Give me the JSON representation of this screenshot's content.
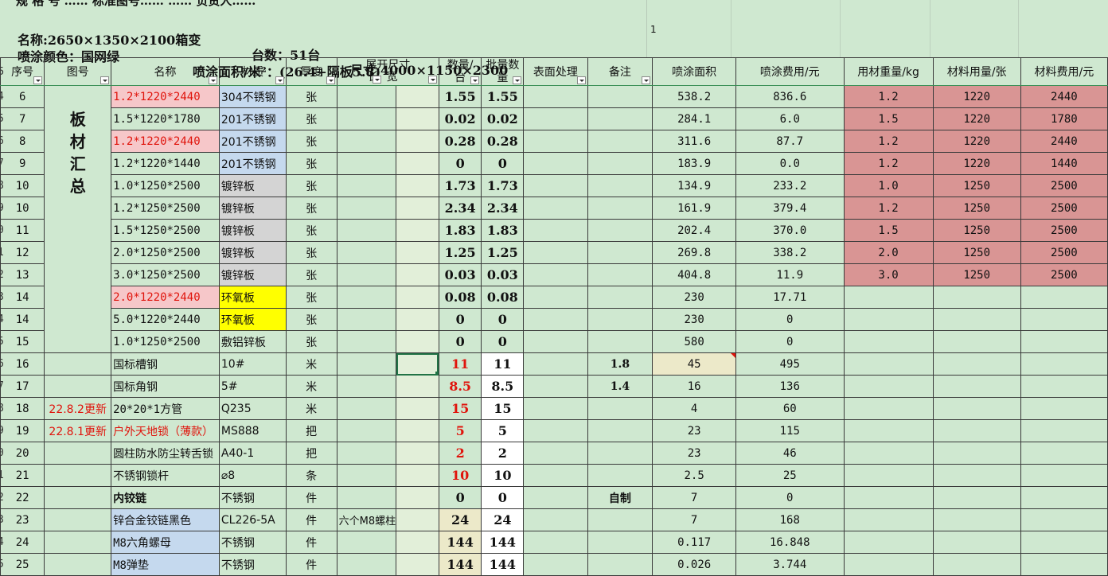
{
  "header": {
    "top_cut": "规 格 号    …… 标准图号……   …… 负责人……",
    "line1_a": "名称:2650×1350×2100箱变",
    "line1_b": "台数：51台",
    "line1_c": "尺寸:4000×1150×2300",
    "line2_a": "喷涂颜色：国网绿",
    "line2_b": "喷涂面积/米²：(26.4+隔板5.8)",
    "right_cell": "1"
  },
  "columns": {
    "seq": "序号",
    "drawing": "图号",
    "name": "名称",
    "material": "材质",
    "thickness": "厚度",
    "unfold_top": "展开尺寸",
    "unfold_len": "长",
    "unfold_wid": "宽",
    "qty_per_unit_1": "数量/",
    "qty_per_unit_2": "台",
    "batch_qty_1": "批量数",
    "batch_qty_2": "量",
    "surface": "表面处理",
    "remark": "备注",
    "spray_area": "喷涂面积",
    "spray_cost": "喷涂费用/元",
    "mat_weight": "用材重量/kg",
    "mat_usage": "材料用量/张",
    "mat_cost": "材料费用/元"
  },
  "group_label": "板材汇总",
  "rows": [
    {
      "rn": "4",
      "seq": "6",
      "drawing": "",
      "name": "1.2*1220*2440",
      "name_style": "pink",
      "material": "304不锈钢",
      "mat_style": "blue",
      "unit": "张",
      "len": "",
      "wid": "",
      "qty": "1.55",
      "batch": "1.55",
      "surface": "",
      "remark": "",
      "area": "538.2",
      "cost": "836.6",
      "w": "1.2",
      "u": "1220",
      "c": "2440",
      "salmon": true
    },
    {
      "rn": "5",
      "seq": "7",
      "drawing": "",
      "name": "1.5*1220*1780",
      "name_style": "",
      "material": "201不锈钢",
      "mat_style": "blue",
      "unit": "张",
      "len": "",
      "wid": "",
      "qty": "0.02",
      "batch": "0.02",
      "surface": "",
      "remark": "",
      "area": "284.1",
      "cost": "6.0",
      "w": "1.5",
      "u": "1220",
      "c": "1780",
      "salmon": true
    },
    {
      "rn": "6",
      "seq": "8",
      "drawing": "",
      "name": "1.2*1220*2440",
      "name_style": "pink",
      "material": "201不锈钢",
      "mat_style": "blue",
      "unit": "张",
      "len": "",
      "wid": "",
      "qty": "0.28",
      "batch": "0.28",
      "surface": "",
      "remark": "",
      "area": "311.6",
      "cost": "87.7",
      "w": "1.2",
      "u": "1220",
      "c": "2440",
      "salmon": true
    },
    {
      "rn": "7",
      "seq": "9",
      "drawing": "",
      "name": "1.2*1220*1440",
      "name_style": "",
      "material": "201不锈钢",
      "mat_style": "blue",
      "unit": "张",
      "len": "",
      "wid": "",
      "qty": "0",
      "batch": "0",
      "surface": "",
      "remark": "",
      "area": "183.9",
      "cost": "0.0",
      "w": "1.2",
      "u": "1220",
      "c": "1440",
      "salmon": true
    },
    {
      "rn": "8",
      "seq": "10",
      "drawing": "",
      "name": "1.0*1250*2500",
      "name_style": "",
      "material": "镀锌板",
      "mat_style": "grey",
      "unit": "张",
      "len": "",
      "wid": "",
      "qty": "1.73",
      "batch": "1.73",
      "surface": "",
      "remark": "",
      "area": "134.9",
      "cost": "233.2",
      "w": "1.0",
      "u": "1250",
      "c": "2500",
      "salmon": true
    },
    {
      "rn": "9",
      "seq": "10",
      "drawing": "",
      "name": "1.2*1250*2500",
      "name_style": "",
      "material": "镀锌板",
      "mat_style": "grey",
      "unit": "张",
      "len": "",
      "wid": "",
      "qty": "2.34",
      "batch": "2.34",
      "surface": "",
      "remark": "",
      "area": "161.9",
      "cost": "379.4",
      "w": "1.2",
      "u": "1250",
      "c": "2500",
      "salmon": true
    },
    {
      "rn": "0",
      "seq": "11",
      "drawing": "",
      "name": "1.5*1250*2500",
      "name_style": "",
      "material": "镀锌板",
      "mat_style": "grey",
      "unit": "张",
      "len": "",
      "wid": "",
      "qty": "1.83",
      "batch": "1.83",
      "surface": "",
      "remark": "",
      "area": "202.4",
      "cost": "370.0",
      "w": "1.5",
      "u": "1250",
      "c": "2500",
      "salmon": true
    },
    {
      "rn": "1",
      "seq": "12",
      "drawing": "",
      "name": "2.0*1250*2500",
      "name_style": "",
      "material": "镀锌板",
      "mat_style": "grey",
      "unit": "张",
      "len": "",
      "wid": "",
      "qty": "1.25",
      "batch": "1.25",
      "surface": "",
      "remark": "",
      "area": "269.8",
      "cost": "338.2",
      "w": "2.0",
      "u": "1250",
      "c": "2500",
      "salmon": true
    },
    {
      "rn": "2",
      "seq": "13",
      "drawing": "",
      "name": "3.0*1250*2500",
      "name_style": "",
      "material": "镀锌板",
      "mat_style": "grey",
      "unit": "张",
      "len": "",
      "wid": "",
      "qty": "0.03",
      "batch": "0.03",
      "surface": "",
      "remark": "",
      "area": "404.8",
      "cost": "11.9",
      "w": "3.0",
      "u": "1250",
      "c": "2500",
      "salmon": true
    },
    {
      "rn": "3",
      "seq": "14",
      "drawing": "",
      "name": "2.0*1220*2440",
      "name_style": "pink-red",
      "material": "环氧板",
      "mat_style": "yellow",
      "unit": "张",
      "len": "",
      "wid": "",
      "qty": "0.08",
      "batch": "0.08",
      "surface": "",
      "remark": "",
      "area": "230",
      "cost": "17.71",
      "w": "",
      "u": "",
      "c": "",
      "salmon": false
    },
    {
      "rn": "4",
      "seq": "14",
      "drawing": "",
      "name": "5.0*1220*2440",
      "name_style": "",
      "material": "环氧板",
      "mat_style": "yellow",
      "unit": "张",
      "len": "",
      "wid": "",
      "qty": "0",
      "batch": "0",
      "surface": "",
      "remark": "",
      "area": "230",
      "cost": "0",
      "w": "",
      "u": "",
      "c": "",
      "salmon": false
    },
    {
      "rn": "5",
      "seq": "15",
      "drawing": "",
      "name": "1.0*1250*2500",
      "name_style": "",
      "material": "敷铝锌板",
      "mat_style": "",
      "unit": "张",
      "len": "",
      "wid": "",
      "qty": "0",
      "batch": "0",
      "surface": "",
      "remark": "",
      "area": "580",
      "cost": "0",
      "w": "",
      "u": "",
      "c": "",
      "salmon": false
    },
    {
      "rn": "6",
      "seq": "16",
      "drawing": "",
      "name": "国标槽钢",
      "name_style": "",
      "material": "10#",
      "mat_style": "",
      "unit": "米",
      "len": "",
      "wid": "",
      "qty": "11",
      "batch": "11",
      "surface": "",
      "remark": "1.8",
      "area": "45",
      "cost": "495",
      "w": "",
      "u": "",
      "c": "",
      "salmon": false
    },
    {
      "rn": "7",
      "seq": "17",
      "drawing": "",
      "name": "国标角钢",
      "name_style": "",
      "material": "5#",
      "mat_style": "",
      "unit": "米",
      "len": "",
      "wid": "",
      "qty": "8.5",
      "batch": "8.5",
      "surface": "",
      "remark": "1.4",
      "area": "16",
      "cost": "136",
      "w": "",
      "u": "",
      "c": "",
      "salmon": false
    },
    {
      "rn": "8",
      "seq": "18",
      "drawing": "22.8.2更新",
      "name": "20*20*1方管",
      "name_style": "",
      "material": "Q235",
      "mat_style": "",
      "unit": "米",
      "len": "",
      "wid": "",
      "qty": "15",
      "batch": "15",
      "surface": "",
      "remark": "",
      "area": "4",
      "cost": "60",
      "w": "",
      "u": "",
      "c": "",
      "salmon": false
    },
    {
      "rn": "9",
      "seq": "19",
      "drawing": "22.8.1更新",
      "name": "户外天地锁（薄款）",
      "name_style": "redtext",
      "material": "MS888",
      "mat_style": "",
      "unit": "把",
      "len": "",
      "wid": "",
      "qty": "5",
      "batch": "5",
      "surface": "",
      "remark": "",
      "area": "23",
      "cost": "115",
      "w": "",
      "u": "",
      "c": "",
      "salmon": false
    },
    {
      "rn": "0",
      "seq": "20",
      "drawing": "",
      "name": "圆柱防水防尘转舌锁",
      "name_style": "",
      "material": "A40-1",
      "mat_style": "",
      "unit": "把",
      "len": "",
      "wid": "",
      "qty": "2",
      "batch": "2",
      "surface": "",
      "remark": "",
      "area": "23",
      "cost": "46",
      "w": "",
      "u": "",
      "c": "",
      "salmon": false
    },
    {
      "rn": "1",
      "seq": "21",
      "drawing": "",
      "name": "不锈钢锁杆",
      "name_style": "",
      "material": "⌀8",
      "mat_style": "",
      "unit": "条",
      "len": "",
      "wid": "",
      "qty": "10",
      "batch": "10",
      "surface": "",
      "remark": "",
      "area": "2.5",
      "cost": "25",
      "w": "",
      "u": "",
      "c": "",
      "salmon": false
    },
    {
      "rn": "2",
      "seq": "22",
      "drawing": "",
      "name": "内铰链",
      "name_style": "boldtext",
      "material": "不锈钢",
      "mat_style": "",
      "unit": "件",
      "len": "",
      "wid": "",
      "qty": "0",
      "batch": "0",
      "surface": "",
      "remark": "自制",
      "area": "7",
      "cost": "0",
      "w": "",
      "u": "",
      "c": "",
      "salmon": false
    },
    {
      "rn": "3",
      "seq": "23",
      "drawing": "",
      "name": "锌合金铰链黑色",
      "name_style": "blue",
      "material": "CL226-5A",
      "mat_style": "",
      "unit": "件",
      "len": "六个M8螺柱",
      "wid": "",
      "qty": "24",
      "batch": "24",
      "surface": "",
      "remark": "",
      "area": "7",
      "cost": "168",
      "w": "",
      "u": "",
      "c": "",
      "salmon": false
    },
    {
      "rn": "4",
      "seq": "24",
      "drawing": "",
      "name": "M8六角螺母",
      "name_style": "blue",
      "material": "不锈钢",
      "mat_style": "",
      "unit": "件",
      "len": "",
      "wid": "",
      "qty": "144",
      "batch": "144",
      "surface": "",
      "remark": "",
      "area": "0.117",
      "cost": "16.848",
      "w": "",
      "u": "",
      "c": "",
      "salmon": false
    },
    {
      "rn": "5",
      "seq": "25",
      "drawing": "",
      "name": "M8弹垫",
      "name_style": "blue",
      "material": "不锈钢",
      "mat_style": "",
      "unit": "件",
      "len": "",
      "wid": "",
      "qty": "144",
      "batch": "144",
      "surface": "",
      "remark": "",
      "area": "0.026",
      "cost": "3.744",
      "w": "",
      "u": "",
      "c": "",
      "salmon": false
    }
  ]
}
